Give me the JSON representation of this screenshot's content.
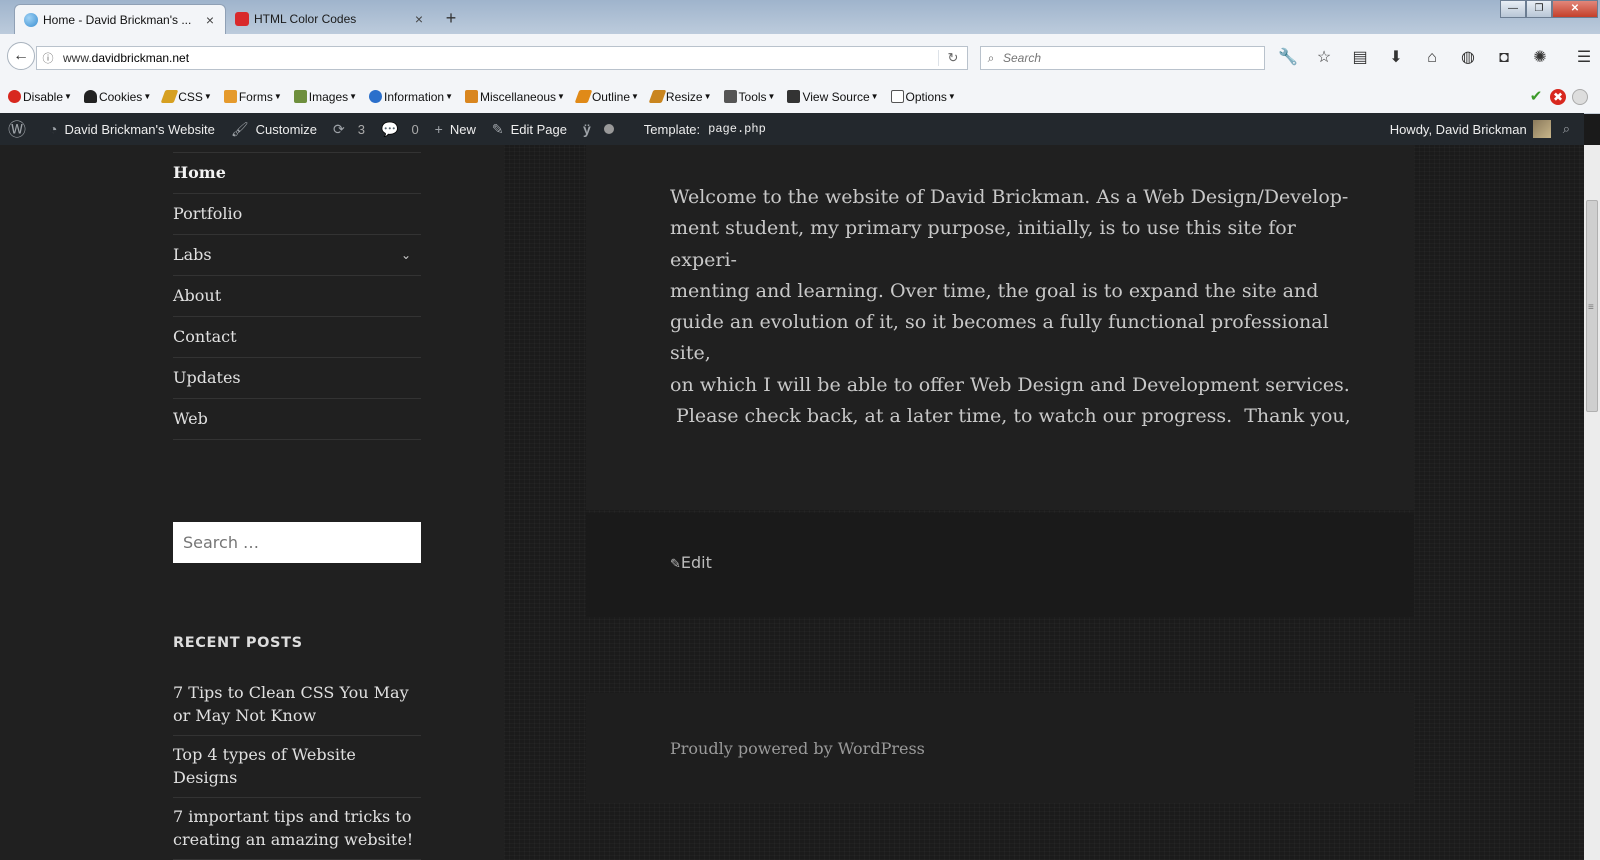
{
  "browser": {
    "tabs": [
      {
        "label": "Home - David Brickman's ...",
        "active": true,
        "favicon_color": "#3b8fd1"
      },
      {
        "label": "HTML Color Codes",
        "active": false,
        "favicon_color": "#d9292b"
      }
    ],
    "new_tab": "+",
    "window_controls": {
      "minimize": "—",
      "maximize": "❐",
      "close": "✕"
    },
    "url": {
      "prefix": "www.",
      "host": "davidbrickman.net"
    },
    "search_placeholder": "Search",
    "nav_icons": [
      "wrench-icon",
      "star-icon",
      "reading-list-icon",
      "download-icon",
      "home-icon",
      "globe-icon",
      "pocket-icon",
      "extension-icon",
      "menu-icon"
    ]
  },
  "dev_toolbar": {
    "items": [
      {
        "label": "Disable",
        "icon": "no-entry-icon",
        "color": "#d8281f"
      },
      {
        "label": "Cookies",
        "icon": "person-icon",
        "color": "#222222"
      },
      {
        "label": "CSS",
        "icon": "pencil-icon",
        "color": "#d6a021"
      },
      {
        "label": "Forms",
        "icon": "form-icon",
        "color": "#e59a2c"
      },
      {
        "label": "Images",
        "icon": "image-icon",
        "color": "#6e8f3d"
      },
      {
        "label": "Information",
        "icon": "info-icon",
        "color": "#2a6fcb"
      },
      {
        "label": "Miscellaneous",
        "icon": "misc-icon",
        "color": "#d9861f"
      },
      {
        "label": "Outline",
        "icon": "outline-pencil-icon",
        "color": "#e08a18"
      },
      {
        "label": "Resize",
        "icon": "resize-icon",
        "color": "#c9851f"
      },
      {
        "label": "Tools",
        "icon": "tools-icon",
        "color": "#555555"
      },
      {
        "label": "View Source",
        "icon": "view-source-icon",
        "color": "#333333"
      },
      {
        "label": "Options",
        "icon": "options-icon",
        "color": "#555555"
      }
    ],
    "status": {
      "ok": "✔",
      "error": "✖"
    }
  },
  "admin_bar": {
    "site_name": "David Brickman's Website",
    "customize": "Customize",
    "updates_count": "3",
    "comments_count": "0",
    "new": "New",
    "edit_page": "Edit Page",
    "template_label": "Template:",
    "template_file": "page.php",
    "howdy": "Howdy, David Brickman"
  },
  "sidebar": {
    "menu": [
      {
        "label": "Home",
        "current": true
      },
      {
        "label": "Portfolio"
      },
      {
        "label": "Labs",
        "has_children": true
      },
      {
        "label": "About"
      },
      {
        "label": "Contact"
      },
      {
        "label": "Updates"
      },
      {
        "label": "Web"
      }
    ],
    "search_placeholder": "Search …",
    "recent_posts_title": "RECENT POSTS",
    "recent_posts": [
      "7 Tips to Clean CSS You May or May Not Know",
      "Top 4 types of Website Designs",
      "7 important tips and tricks to creating an amazing website!"
    ]
  },
  "main": {
    "lines": [
      "Welcome to the website of David Brickman. As a Web Design/Develop-",
      "ment student, my primary purpose, initially, is to use this site for experi-",
      "menting and learning.  Over time, the goal is to expand the site and",
      "guide an evolution of it, so it becomes a fully functional professional site,",
      "on which I will be able to offer Web Design and Development services.",
      " Please check back, at a later time, to watch our progress.  Thank you,"
    ],
    "edit_label": "Edit",
    "footer_credit": "Proudly powered by WordPress"
  }
}
